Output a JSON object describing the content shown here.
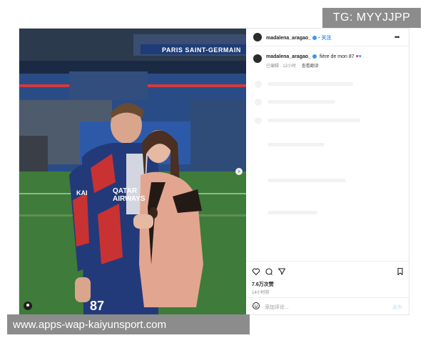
{
  "watermark_top": "TG: MYYJJPP",
  "watermark_bottom": "www.apps-wap-kaiyunsport.com",
  "post": {
    "username": "madalena_aragao_",
    "follow_label": "关注",
    "more_icon": "more-horizontal-icon",
    "caption": "fière de mon 87",
    "caption_meta": "已编辑 · 12小时",
    "translate_label": "查看翻译",
    "likes": "7.6万次赞",
    "time_ago": "14小时前",
    "comment_placeholder": "添加评论...",
    "post_label": "发布",
    "stadium_sign": "PARIS SAINT-GERMAIN",
    "jersey_sponsor": "QATAR AIRWAYS",
    "jersey_number": "87",
    "jersey_text": "KAI",
    "icons": {
      "like": "heart-icon",
      "comment": "comment-icon",
      "share": "send-icon",
      "save": "bookmark-icon",
      "emoji": "emoji-icon",
      "tag": "user-tag-icon",
      "next": "chevron-right-icon"
    },
    "colors": {
      "accent": "#3897f0",
      "heart": "#e0245e",
      "heart_blue": "#3897f0"
    }
  }
}
